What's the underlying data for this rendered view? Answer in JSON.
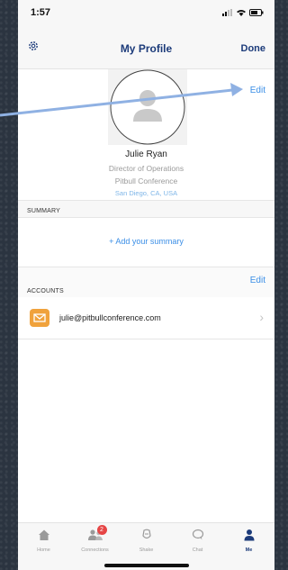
{
  "status": {
    "time": "1:57"
  },
  "nav": {
    "title": "My Profile",
    "done": "Done"
  },
  "profile": {
    "edit": "Edit",
    "name": "Julie Ryan",
    "title": "Director of Operations",
    "company": "Pitbull Conference",
    "location": "San Diego, CA, USA"
  },
  "summary": {
    "header": "SUMMARY",
    "add": "+ Add your summary"
  },
  "accounts": {
    "header": "ACCOUNTS",
    "edit": "Edit",
    "items": [
      {
        "email": "julie@pitbullconference.com"
      }
    ]
  },
  "tabs": [
    {
      "label": "Home",
      "icon": "home-icon"
    },
    {
      "label": "Connections",
      "icon": "connections-icon",
      "badge": "2"
    },
    {
      "label": "Shake",
      "icon": "shake-icon"
    },
    {
      "label": "Chat",
      "icon": "chat-icon"
    },
    {
      "label": "Me",
      "icon": "person-icon"
    }
  ],
  "colors": {
    "accent": "#3a8ee6",
    "nav_text": "#1c3b7a",
    "mail_badge": "#f0a23c",
    "badge_red": "#e64545",
    "arrow": "#8fb1e3"
  }
}
